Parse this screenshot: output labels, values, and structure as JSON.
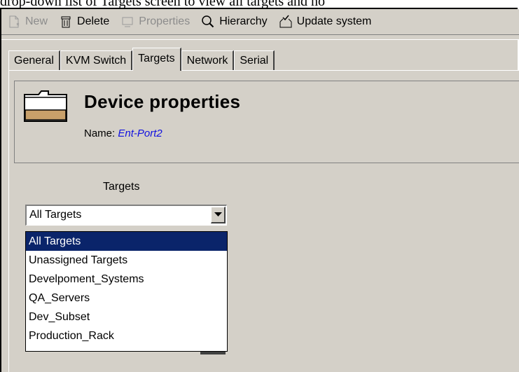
{
  "caption": "drop-down list of Targets screen to view all targets and no",
  "toolbar": {
    "new_label": "New",
    "delete_label": "Delete",
    "properties_label": "Properties",
    "hierarchy_label": "Hierarchy",
    "update_label": "Update system"
  },
  "tabs": [
    {
      "label": "General",
      "active": false
    },
    {
      "label": "KVM Switch",
      "active": false
    },
    {
      "label": "Targets",
      "active": true
    },
    {
      "label": "Network",
      "active": false
    },
    {
      "label": "Serial",
      "active": false
    }
  ],
  "header": {
    "title": "Device properties",
    "name_label": "Name:",
    "name_value": "Ent-Port2"
  },
  "targets": {
    "label": "Targets",
    "selected": "All Targets",
    "options": [
      "All Targets",
      "Unassigned Targets",
      "Develpoment_Systems",
      "QA_Servers",
      "Dev_Subset",
      "Production_Rack"
    ]
  },
  "colors": {
    "window_bg": "#d4d0c8",
    "selection_bg": "#0a246a",
    "link_blue": "#1010e0"
  }
}
